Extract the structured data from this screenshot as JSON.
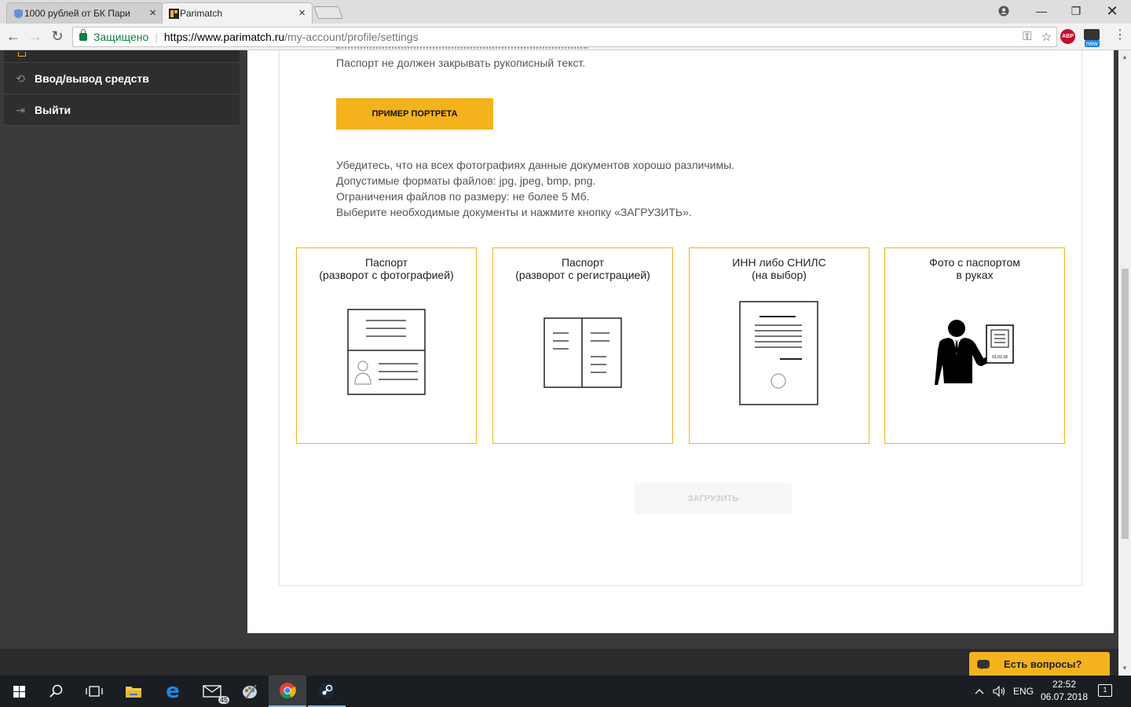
{
  "browser": {
    "tabs": [
      {
        "title": "1000 рублей от БК Пари",
        "active": false
      },
      {
        "title": "Parimatch",
        "active": true
      }
    ],
    "secure_label": "Защищено",
    "url_host": "https://www.parimatch.ru",
    "url_path": "/my-account/profile/settings",
    "abp_label": "ABP",
    "mail_badge": "new"
  },
  "sidebar": {
    "items": [
      {
        "label": "Ввод/вывод средств",
        "icon": "transfer-icon"
      },
      {
        "label": "Выйти",
        "icon": "logout-icon"
      }
    ]
  },
  "main": {
    "passport_note": "Паспорт не должен закрывать рукописный текст.",
    "example_button": "ПРИМЕР ПОРТРЕТА",
    "instructions": [
      "Убедитесь, что на всех фотографиях данные документов хорошо различимы.",
      "Допустимые форматы файлов: jpg, jpeg, bmp, png.",
      "Ограничения файлов по размеру: не более 5 Мб.",
      "Выберите необходимые документы и нажмите кнопку «ЗАГРУЗИТЬ»."
    ],
    "cards": [
      {
        "title": "Паспорт\n(разворот с фотографией)",
        "icon": "passport-photo-page-icon"
      },
      {
        "title": "Паспорт\n(разворот с регистрацией)",
        "icon": "passport-registration-page-icon"
      },
      {
        "title": "ИНН либо СНИЛС\n(на выбор)",
        "icon": "tax-document-icon"
      },
      {
        "title": "Фото с паспортом\nв руках",
        "icon": "person-holding-passport-icon"
      }
    ],
    "document_date": "01.01.18",
    "upload_button": "ЗАГРУЗИТЬ"
  },
  "chat": {
    "label": "Есть вопросы?"
  },
  "taskbar": {
    "mail_count": "45",
    "lang": "ENG",
    "time": "22:52",
    "date": "06.07.2018",
    "notifications": "1"
  },
  "colors": {
    "accent": "#f4b21d",
    "sidebar_bg": "#2e2e2e",
    "secure_green": "#0b8043"
  }
}
